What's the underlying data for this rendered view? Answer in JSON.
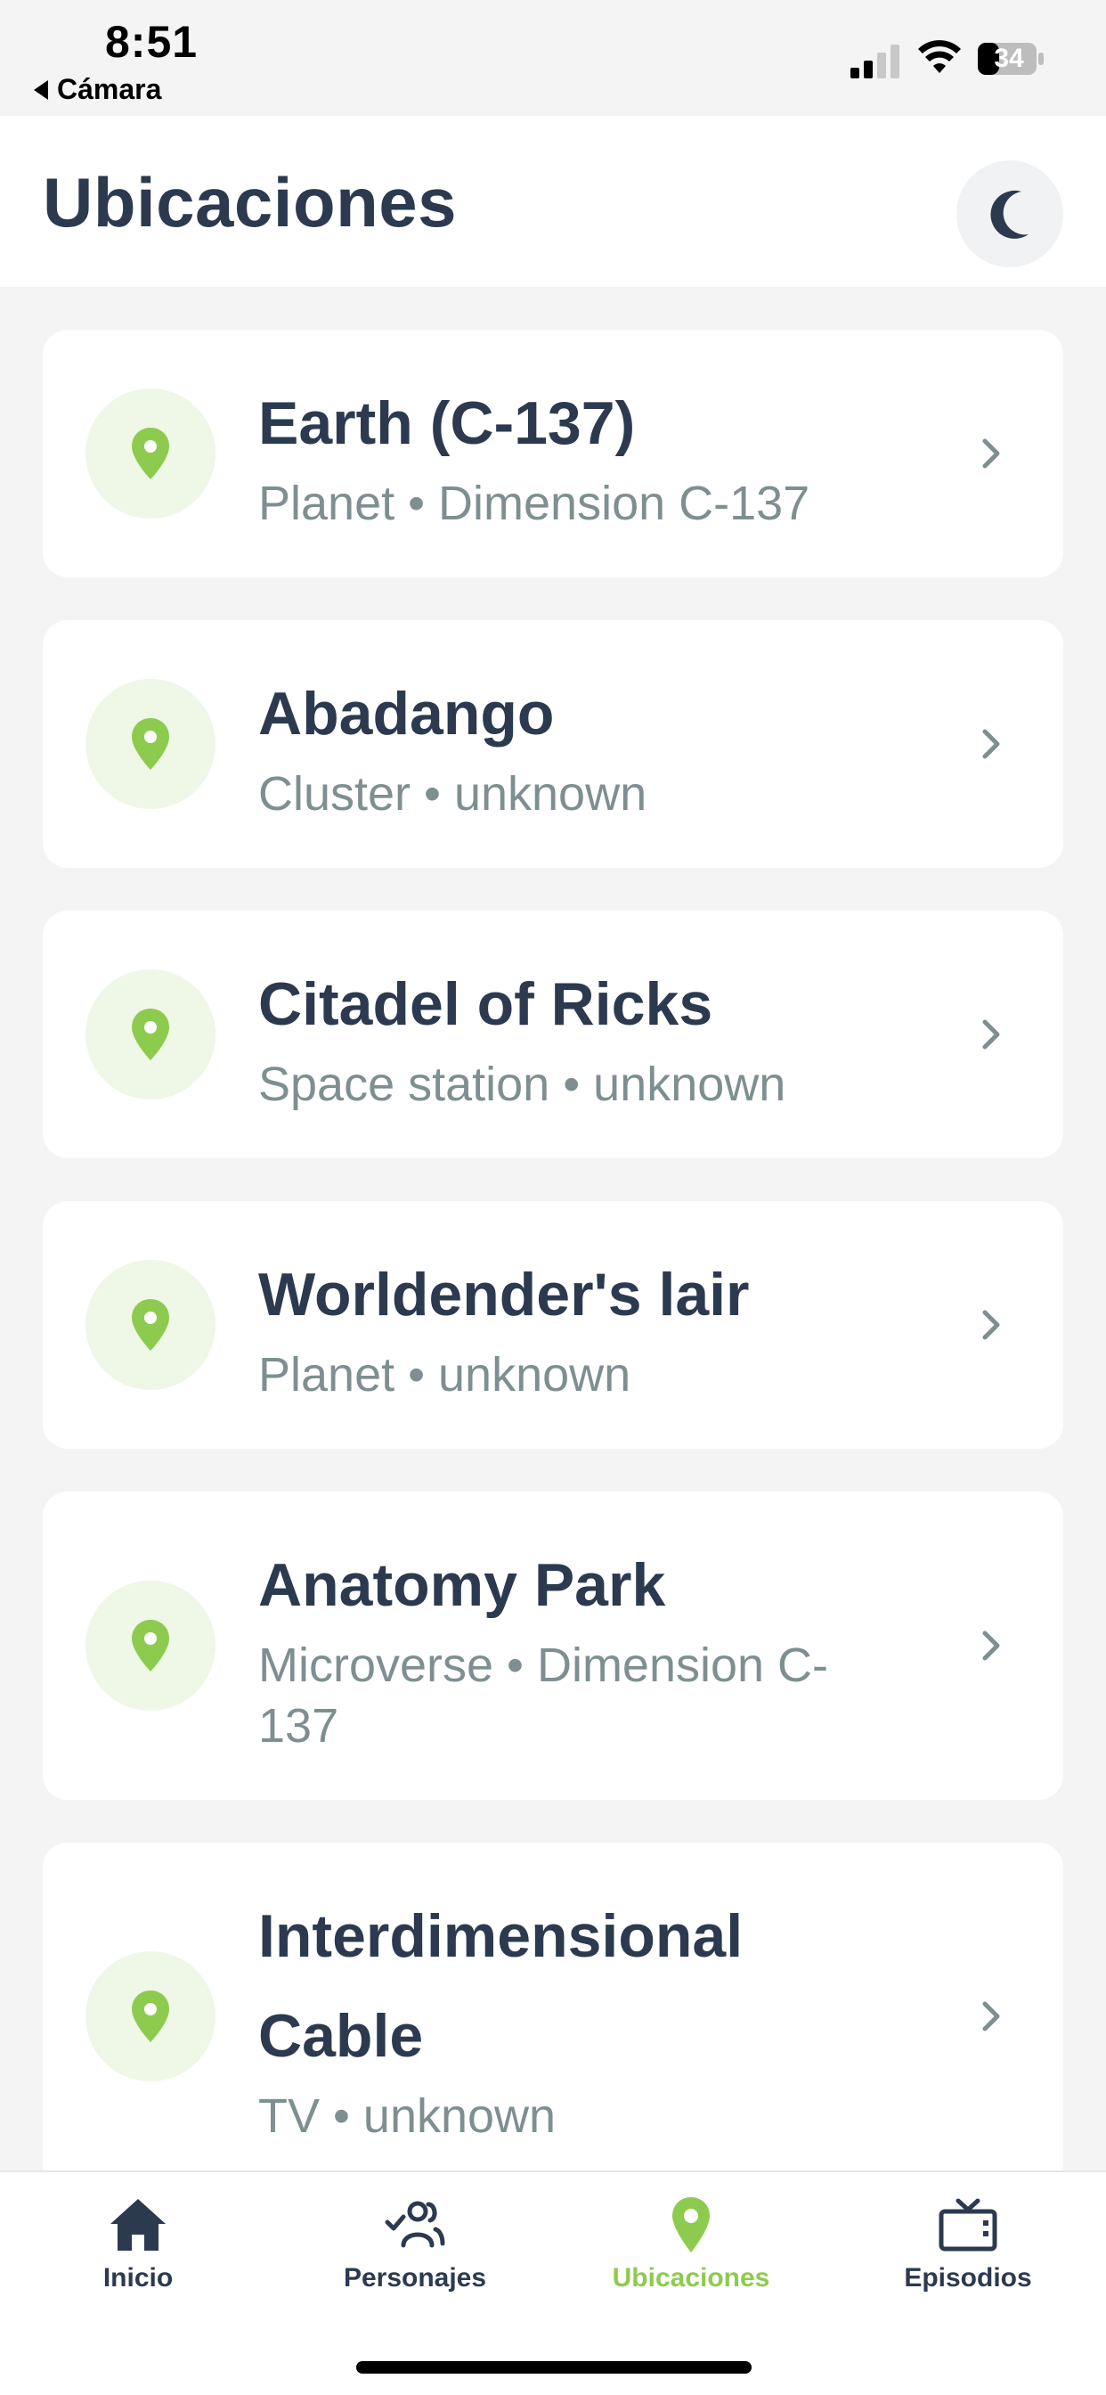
{
  "status_bar": {
    "time": "8:51",
    "back_app": "Cámara",
    "battery": "34"
  },
  "header": {
    "title": "Ubicaciones",
    "theme_icon": "moon-icon"
  },
  "colors": {
    "primary_text": "#2b3a4f",
    "secondary_text": "#7e8f91",
    "accent_green": "#8dcb4f",
    "pin_circle_bg": "#eff7e6"
  },
  "locations": [
    {
      "name": "Earth (C-137)",
      "meta": "Planet • Dimension C-137"
    },
    {
      "name": "Abadango",
      "meta": "Cluster • unknown"
    },
    {
      "name": "Citadel of Ricks",
      "meta": "Space station • unknown"
    },
    {
      "name": "Worldender's lair",
      "meta": "Planet • unknown"
    },
    {
      "name": "Anatomy Park",
      "meta": "Microverse • Dimension C-137"
    },
    {
      "name": "Interdimensional Cable",
      "meta": "TV • unknown"
    }
  ],
  "bottom_nav": {
    "items": [
      {
        "label": "Inicio",
        "icon": "home-icon"
      },
      {
        "label": "Personajes",
        "icon": "people-icon"
      },
      {
        "label": "Ubicaciones",
        "icon": "location-pin-icon",
        "active": true
      },
      {
        "label": "Episodios",
        "icon": "tv-icon"
      }
    ]
  }
}
